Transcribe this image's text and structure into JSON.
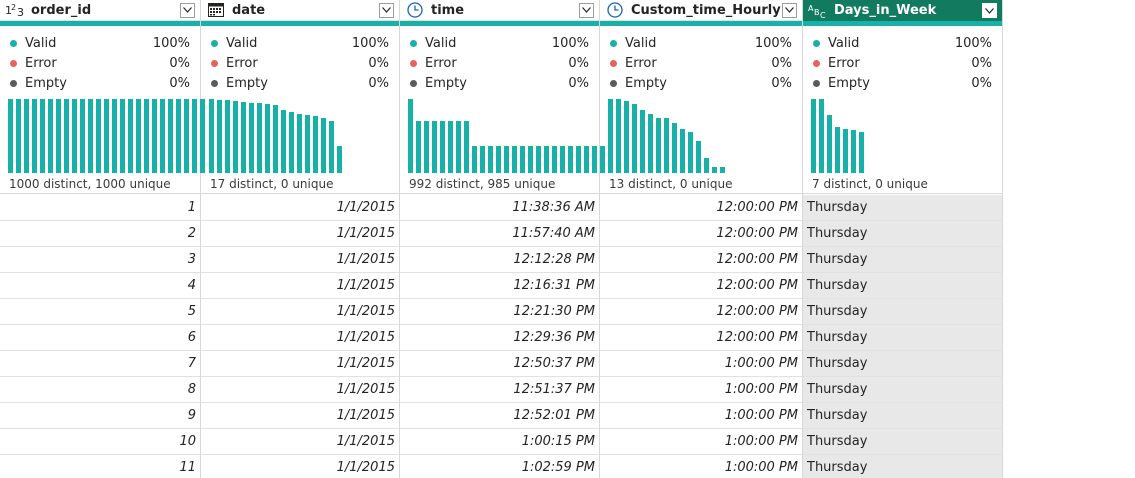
{
  "columns": [
    {
      "key": "order_id",
      "name": "order_id",
      "type_icon": "number-type-icon",
      "type_glyph": "1²3",
      "quality": {
        "valid_label": "Valid",
        "valid_pct": "100%",
        "error_label": "Error",
        "error_pct": "0%",
        "empty_label": "Empty",
        "empty_pct": "0%"
      },
      "distribution": [
        1,
        1,
        1,
        1,
        1,
        1,
        1,
        1,
        1,
        1,
        1,
        1,
        1,
        1,
        1,
        1,
        1,
        1,
        1,
        1,
        1,
        1,
        1,
        1,
        1
      ],
      "distinct_text": "1000 distinct, 1000 unique",
      "align": "right",
      "values": [
        "1",
        "2",
        "3",
        "4",
        "5",
        "6",
        "7",
        "8",
        "9",
        "10",
        "11"
      ]
    },
    {
      "key": "date",
      "name": "date",
      "type_icon": "calendar-type-icon",
      "quality": {
        "valid_label": "Valid",
        "valid_pct": "100%",
        "error_label": "Error",
        "error_pct": "0%",
        "empty_label": "Empty",
        "empty_pct": "0%"
      },
      "distribution": [
        1,
        0.99,
        0.98,
        0.97,
        0.96,
        0.95,
        0.94,
        0.93,
        0.92,
        0.85,
        0.82,
        0.8,
        0.79,
        0.77,
        0.74,
        0.7,
        0.37
      ],
      "distinct_text": "17 distinct, 0 unique",
      "align": "right",
      "values": [
        "1/1/2015",
        "1/1/2015",
        "1/1/2015",
        "1/1/2015",
        "1/1/2015",
        "1/1/2015",
        "1/1/2015",
        "1/1/2015",
        "1/1/2015",
        "1/1/2015",
        "1/1/2015"
      ]
    },
    {
      "key": "time",
      "name": "time",
      "type_icon": "clock-type-icon",
      "quality": {
        "valid_label": "Valid",
        "valid_pct": "100%",
        "error_label": "Error",
        "error_pct": "0%",
        "empty_label": "Empty",
        "empty_pct": "0%"
      },
      "distribution": [
        1,
        0.7,
        0.7,
        0.7,
        0.7,
        0.7,
        0.7,
        0.7,
        0.37,
        0.37,
        0.37,
        0.37,
        0.37,
        0.37,
        0.37,
        0.37,
        0.37,
        0.37,
        0.37,
        0.37,
        0.37,
        0.37,
        0.37,
        0.37,
        0.37
      ],
      "distinct_text": "992 distinct, 985 unique",
      "align": "right",
      "values": [
        "11:38:36 AM",
        "11:57:40 AM",
        "12:12:28 PM",
        "12:16:31 PM",
        "12:21:30 PM",
        "12:29:36 PM",
        "12:50:37 PM",
        "12:51:37 PM",
        "12:52:01 PM",
        "1:00:15 PM",
        "1:02:59 PM"
      ]
    },
    {
      "key": "custom_time_hourly",
      "name": "Custom_time_Hourly",
      "type_icon": "clock-type-icon",
      "quality": {
        "valid_label": "Valid",
        "valid_pct": "100%",
        "error_label": "Error",
        "error_pct": "0%",
        "empty_label": "Empty",
        "empty_pct": "0%"
      },
      "distribution": [
        1,
        1,
        0.97,
        0.93,
        0.85,
        0.8,
        0.74,
        0.74,
        0.67,
        0.6,
        0.55,
        0.43,
        0.2,
        0.08,
        0.08
      ],
      "distinct_text": "13 distinct, 0 unique",
      "align": "right",
      "values": [
        "12:00:00 PM",
        "12:00:00 PM",
        "12:00:00 PM",
        "12:00:00 PM",
        "12:00:00 PM",
        "12:00:00 PM",
        "1:00:00 PM",
        "1:00:00 PM",
        "1:00:00 PM",
        "1:00:00 PM",
        "1:00:00 PM"
      ]
    },
    {
      "key": "days_in_week",
      "name": "Days_in_Week",
      "type_icon": "text-type-icon",
      "type_glyph": "ABC",
      "quality": {
        "valid_label": "Valid",
        "valid_pct": "100%",
        "error_label": "Error",
        "error_pct": "0%",
        "empty_label": "Empty",
        "empty_pct": "0%"
      },
      "distribution": [
        1,
        1,
        0.78,
        0.62,
        0.59,
        0.58,
        0.56
      ],
      "distinct_text": "7 distinct, 0 unique",
      "align": "left",
      "selected": true,
      "values": [
        "Thursday",
        "Thursday",
        "Thursday",
        "Thursday",
        "Thursday",
        "Thursday",
        "Thursday",
        "Thursday",
        "Thursday",
        "Thursday",
        "Thursday"
      ]
    }
  ],
  "colors": {
    "bar": "#18b1a7",
    "valid_dot": "#18b1a7",
    "error_dot": "#e8625b",
    "empty_dot": "#5a5a5a",
    "selected_header": "#127a5e",
    "accent": "#18b1a7"
  }
}
